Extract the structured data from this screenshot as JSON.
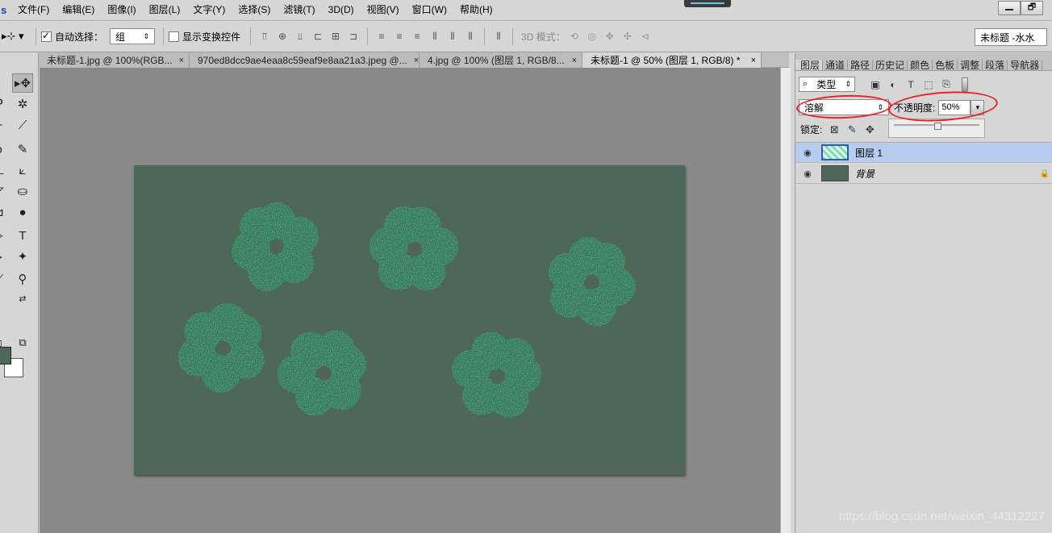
{
  "menubar": {
    "logo": "s",
    "items": [
      "文件(F)",
      "编辑(E)",
      "图像(I)",
      "图层(L)",
      "文字(Y)",
      "选择(S)",
      "滤镜(T)",
      "3D(D)",
      "视图(V)",
      "窗口(W)",
      "帮助(H)"
    ],
    "minimize": "",
    "restore": "🗗"
  },
  "options": {
    "auto_select_label": "自动选择：",
    "auto_select_value": "组",
    "show_transform_label": "显示变换控件",
    "mode_3d_label": "3D 模式：",
    "workspace_value": "未标题 -水水"
  },
  "tabs": [
    {
      "label": "未标题-1.jpg @ 100%(RGB...",
      "close": "×"
    },
    {
      "label": "970ed8dcc9ae4eaa8c59eaf9e8aa21a3.jpeg @...",
      "close": "×"
    },
    {
      "label": "4.jpg @ 100% (图层 1, RGB/8...",
      "close": "×"
    },
    {
      "label": "未标题-1 @ 50% (图层 1, RGB/8) *",
      "close": "×"
    }
  ],
  "panel": {
    "tabs": [
      "图层",
      "通道",
      "路径",
      "历史记",
      "颜色",
      "色板",
      "调整",
      "段落",
      "导航器"
    ],
    "kind_filter": "类型",
    "blend_mode": "溶解",
    "opacity_label": "不透明度:",
    "opacity_value": "50%",
    "lock_label": "锁定:",
    "layers": [
      {
        "name": "图层 1",
        "selected": true
      },
      {
        "name": "背景",
        "selected": false
      }
    ]
  },
  "colors": {
    "canvas_bg": "#4f665a",
    "flower": "#1fd88a",
    "foreground_swatch": "#4f665a",
    "background_swatch": "#ffffff",
    "annotation": "#e8232a"
  },
  "watermark": "https://blog.csdn.net/weixin_44312227"
}
